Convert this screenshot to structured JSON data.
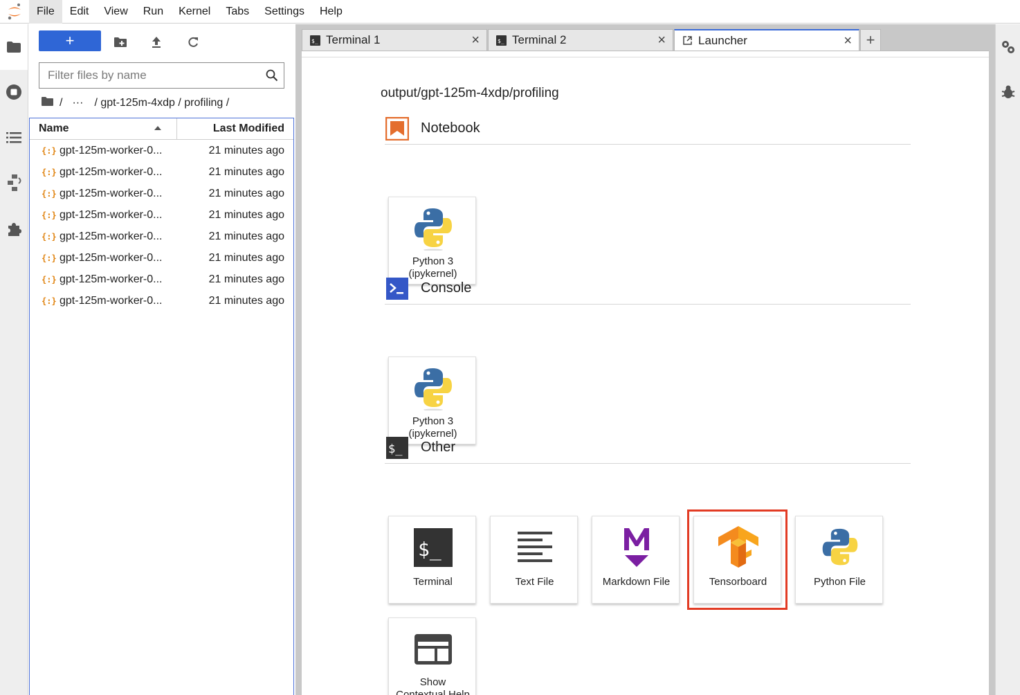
{
  "menubar": {
    "items": [
      "File",
      "Edit",
      "View",
      "Run",
      "Kernel",
      "Tabs",
      "Settings",
      "Help"
    ],
    "active": "File"
  },
  "activity_left": [
    "folder-icon",
    "running-icon",
    "toc-icon",
    "git-icon",
    "extension-icon"
  ],
  "activity_right": [
    "property-inspector-icon",
    "debugger-icon"
  ],
  "filebrowser": {
    "new_label": "+",
    "filter_placeholder": "Filter files by name",
    "breadcrumb": {
      "root": "/",
      "ellipsis": "···",
      "path": "/ gpt-125m-4xdp / profiling /"
    },
    "columns": {
      "name": "Name",
      "modified": "Last Modified"
    },
    "files": [
      {
        "icon": "{:}",
        "name": "gpt-125m-worker-0...",
        "modified": "21 minutes ago"
      },
      {
        "icon": "{:}",
        "name": "gpt-125m-worker-0...",
        "modified": "21 minutes ago"
      },
      {
        "icon": "{:}",
        "name": "gpt-125m-worker-0...",
        "modified": "21 minutes ago"
      },
      {
        "icon": "{:}",
        "name": "gpt-125m-worker-0...",
        "modified": "21 minutes ago"
      },
      {
        "icon": "{:}",
        "name": "gpt-125m-worker-0...",
        "modified": "21 minutes ago"
      },
      {
        "icon": "{:}",
        "name": "gpt-125m-worker-0...",
        "modified": "21 minutes ago"
      },
      {
        "icon": "{:}",
        "name": "gpt-125m-worker-0...",
        "modified": "21 minutes ago"
      },
      {
        "icon": "{:}",
        "name": "gpt-125m-worker-0...",
        "modified": "21 minutes ago"
      }
    ]
  },
  "tabs": [
    {
      "label": "Terminal 1",
      "icon": "terminal-icon",
      "active": false
    },
    {
      "label": "Terminal 2",
      "icon": "terminal-icon",
      "active": false
    },
    {
      "label": "Launcher",
      "icon": "launcher-icon",
      "active": true
    }
  ],
  "tab_close": "×",
  "add_tab": "+",
  "launcher": {
    "cwd": "output/gpt-125m-4xdp/profiling",
    "sections": {
      "notebook": {
        "label": "Notebook",
        "cards": [
          {
            "line1": "Python 3",
            "line2": "(ipykernel)"
          }
        ]
      },
      "console": {
        "label": "Console",
        "cards": [
          {
            "line1": "Python 3",
            "line2": "(ipykernel)"
          }
        ]
      },
      "other": {
        "label": "Other",
        "cards": [
          {
            "label": "Terminal"
          },
          {
            "label": "Text File"
          },
          {
            "label": "Markdown File"
          },
          {
            "label": "Tensorboard",
            "highlighted": true
          },
          {
            "label": "Python File"
          },
          {
            "line1": "Show",
            "line2": "Contextual Help"
          }
        ]
      }
    }
  },
  "colors": {
    "accent": "#2f66d6",
    "highlight": "#e23b24",
    "json_icon": "#e0830f",
    "notebook": "#e46e2e",
    "console": "#3457c7",
    "markdown": "#7b1fa2",
    "tensorflow": "#f48b1e"
  }
}
